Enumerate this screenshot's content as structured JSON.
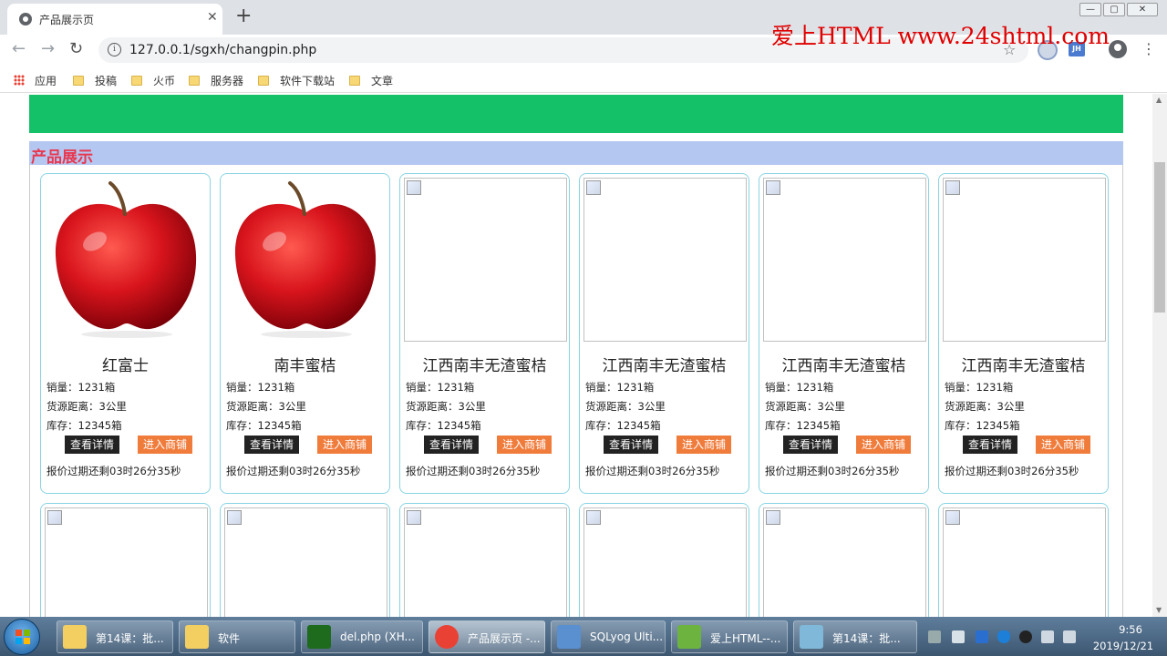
{
  "browser": {
    "tab_title": "产品展示页",
    "tab_close": "✕",
    "new_tab": "+",
    "url": "127.0.0.1/sgxh/changpin.php",
    "info_glyph": "i",
    "star_glyph": "☆",
    "ext2_label": "JH",
    "menu_glyph": "⋮",
    "back_glyph": "←",
    "forward_glyph": "→",
    "reload_glyph": "↻",
    "window_controls": {
      "minimize": "—",
      "maximize": "▢",
      "close": "✕"
    }
  },
  "watermark": "爱上HTML www.24shtml.com",
  "bookmarks": [
    {
      "label": "应用",
      "icon": "apps-icon"
    },
    {
      "label": "投稿",
      "icon": "folder-icon"
    },
    {
      "label": "火币",
      "icon": "folder-icon"
    },
    {
      "label": "服务器",
      "icon": "folder-icon"
    },
    {
      "label": "软件下载站",
      "icon": "folder-icon"
    },
    {
      "label": "文章",
      "icon": "folder-icon"
    }
  ],
  "page": {
    "banner_color": "#14c068",
    "section_title": "产品展示",
    "section_bar_color": "#b4c7f1",
    "products": [
      {
        "name": "红富士",
        "sales": "销量：1231箱",
        "distance": "货源距离：3公里",
        "stock": "库存：12345箱",
        "detail_btn": "查看详情",
        "shop_btn": "进入商铺",
        "timer": "报价过期还剩03时26分35秒",
        "image": "apple"
      },
      {
        "name": "南丰蜜桔",
        "sales": "销量：1231箱",
        "distance": "货源距离：3公里",
        "stock": "库存：12345箱",
        "detail_btn": "查看详情",
        "shop_btn": "进入商铺",
        "timer": "报价过期还剩03时26分35秒",
        "image": "apple"
      },
      {
        "name": "江西南丰无渣蜜桔",
        "sales": "销量：1231箱",
        "distance": "货源距离：3公里",
        "stock": "库存：12345箱",
        "detail_btn": "查看详情",
        "shop_btn": "进入商铺",
        "timer": "报价过期还剩03时26分35秒",
        "image": "broken"
      },
      {
        "name": "江西南丰无渣蜜桔",
        "sales": "销量：1231箱",
        "distance": "货源距离：3公里",
        "stock": "库存：12345箱",
        "detail_btn": "查看详情",
        "shop_btn": "进入商铺",
        "timer": "报价过期还剩03时26分35秒",
        "image": "broken"
      },
      {
        "name": "江西南丰无渣蜜桔",
        "sales": "销量：1231箱",
        "distance": "货源距离：3公里",
        "stock": "库存：12345箱",
        "detail_btn": "查看详情",
        "shop_btn": "进入商铺",
        "timer": "报价过期还剩03时26分35秒",
        "image": "broken"
      },
      {
        "name": "江西南丰无渣蜜桔",
        "sales": "销量：1231箱",
        "distance": "货源距离：3公里",
        "stock": "库存：12345箱",
        "detail_btn": "查看详情",
        "shop_btn": "进入商铺",
        "timer": "报价过期还剩03时26分35秒",
        "image": "broken"
      }
    ]
  },
  "taskbar": {
    "items": [
      {
        "label": "第14课：批...",
        "icon": "folder-icon",
        "color": "#f3cf62"
      },
      {
        "label": "软件",
        "icon": "folder-icon",
        "color": "#f3cf62"
      },
      {
        "label": "del.php (XH...",
        "icon": "dreamweaver-icon",
        "color": "#1e6b1e"
      },
      {
        "label": "产品展示页 -...",
        "icon": "chrome-icon",
        "color": "#e94235"
      },
      {
        "label": "SQLyog Ulti...",
        "icon": "sqlyog-icon",
        "color": "#5a8fd0"
      },
      {
        "label": "爱上HTML--...",
        "icon": "app-icon",
        "color": "#6db33f"
      },
      {
        "label": "第14课：批...",
        "icon": "notepad-icon",
        "color": "#7fb8d8"
      }
    ],
    "time": "9:56",
    "date": "2019/12/21"
  }
}
